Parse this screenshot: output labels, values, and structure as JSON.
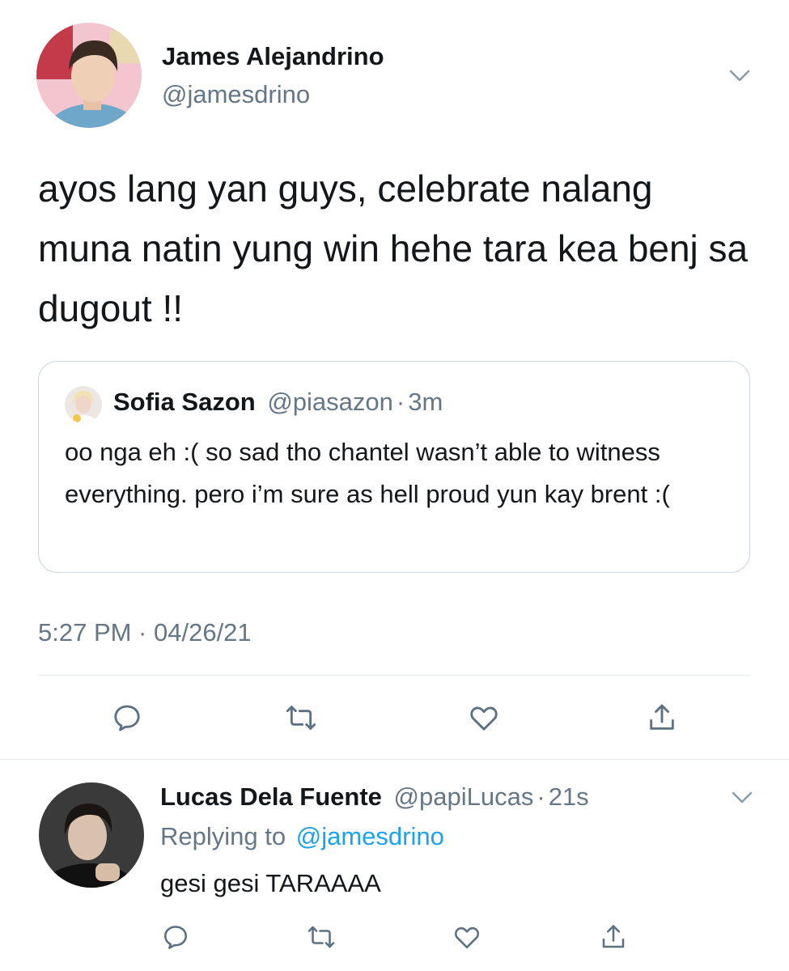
{
  "main_tweet": {
    "author": {
      "name": "James Alejandrino",
      "handle": "@jamesdrino"
    },
    "text": "ayos lang yan guys, celebrate nalang muna natin yung win hehe tara kea benj sa dugout !!",
    "quoted": {
      "name": "Sofia Sazon",
      "handle": "@piasazon",
      "separator": "·",
      "time": "3m",
      "text": "oo nga eh :( so sad tho chantel wasn’t able to witness everything. pero i’m sure as hell proud yun kay brent :("
    },
    "timestamp": "5:27 PM · 04/26/21",
    "actions": [
      "reply-icon",
      "retweet-icon",
      "like-icon",
      "share-icon"
    ]
  },
  "reply": {
    "name": "Lucas Dela Fuente",
    "handle": "@papiLucas",
    "separator": "·",
    "time": "21s",
    "replying_prefix": "Replying to",
    "replying_to": "@jamesdrino",
    "text": "gesi gesi TARAAAA",
    "actions": [
      "reply-icon",
      "retweet-icon",
      "like-icon",
      "share-icon"
    ]
  },
  "colors": {
    "link": "#1da1f2",
    "muted": "#657786",
    "icon": "#5b7083",
    "divider": "#e6ecf0"
  }
}
